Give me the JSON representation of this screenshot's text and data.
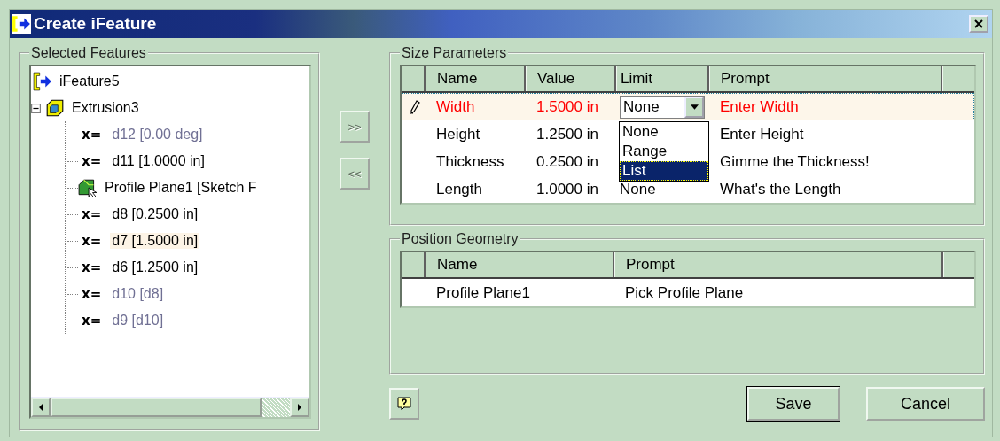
{
  "window": {
    "title": "Create iFeature"
  },
  "selected_features": {
    "title": "Selected Features",
    "tree": [
      {
        "label": "iFeature5",
        "kind": "feature",
        "children": [
          {
            "label": "Extrusion3",
            "kind": "extrusion",
            "expanded": true,
            "children": [
              {
                "label": "d12 [0.00 deg]",
                "kind": "parameter",
                "symbol": "x=",
                "dimmed": true,
                "highlighted": false
              },
              {
                "label": "d11 [1.0000 in]",
                "kind": "parameter",
                "symbol": "x=",
                "dimmed": false,
                "highlighted": false
              },
              {
                "label": "Profile Plane1 [Sketch F",
                "kind": "sketch",
                "dimmed": false,
                "highlighted": false
              },
              {
                "label": "d8 [0.2500 in]",
                "kind": "parameter",
                "symbol": "x=",
                "dimmed": false,
                "highlighted": false
              },
              {
                "label": "d7 [1.5000 in]",
                "kind": "parameter",
                "symbol": "x=",
                "dimmed": false,
                "highlighted": true
              },
              {
                "label": "d6 [1.2500 in]",
                "kind": "parameter",
                "symbol": "x=",
                "dimmed": false,
                "highlighted": false
              },
              {
                "label": "d10 [d8]",
                "kind": "parameter",
                "symbol": "x=",
                "dimmed": true,
                "highlighted": false
              },
              {
                "label": "d9 [d10]",
                "kind": "parameter",
                "symbol": "x=",
                "dimmed": true,
                "highlighted": false
              }
            ]
          }
        ]
      }
    ]
  },
  "move_buttons": [
    ">>",
    "<<"
  ],
  "size_parameters": {
    "title": "Size Parameters",
    "columns": [
      "Name",
      "Value",
      "Limit",
      "Prompt"
    ],
    "rows": [
      {
        "name": "Width",
        "value": "1.5000 in",
        "limit": "None",
        "prompt": "Enter Width",
        "selected": true
      },
      {
        "name": "Height",
        "value": "1.2500 in",
        "prompt": "Enter Height",
        "selected": false
      },
      {
        "name": "Thickness",
        "value": "0.2500 in",
        "prompt": "Gimme the Thickness!",
        "selected": false
      },
      {
        "name": "Length",
        "value": "1.0000 in",
        "limit": "None",
        "prompt": "What's the Length",
        "selected": false
      }
    ],
    "limit_options": [
      {
        "label": "None",
        "selected": false
      },
      {
        "label": "Range",
        "selected": false
      },
      {
        "label": "List",
        "selected": true
      }
    ]
  },
  "position_geometry": {
    "title": "Position Geometry",
    "columns": [
      "Name",
      "Prompt"
    ],
    "rows": [
      {
        "name": "Profile Plane1",
        "prompt": "Pick Profile Plane",
        "selected": false
      }
    ]
  },
  "buttons": [
    "Save",
    "Cancel"
  ]
}
